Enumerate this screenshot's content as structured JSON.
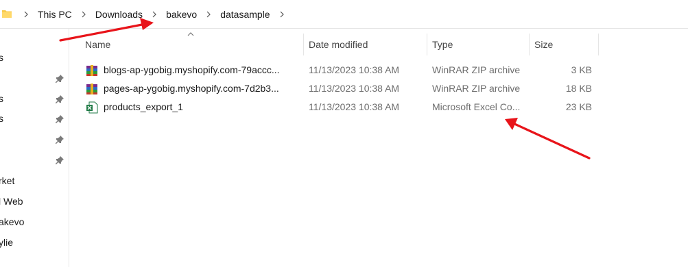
{
  "breadcrumb": {
    "items": [
      "This PC",
      "Downloads",
      "bakevo",
      "datasample"
    ]
  },
  "nav_pane": {
    "items": [
      {
        "label": "s",
        "pinned": false
      },
      {
        "label": "s",
        "pinned": true
      },
      {
        "label": "s",
        "pinned": true
      },
      {
        "label": "",
        "pinned": true
      },
      {
        "label": "",
        "pinned": true
      },
      {
        "label": "rket",
        "pinned": false
      },
      {
        "label": "l Web",
        "pinned": false
      },
      {
        "label": "akevo",
        "pinned": false
      },
      {
        "label": "ylie",
        "pinned": false
      }
    ]
  },
  "columns": {
    "name": "Name",
    "date": "Date modified",
    "type": "Type",
    "size": "Size"
  },
  "files": [
    {
      "icon": "winrar-archive-icon",
      "name": "blogs-ap-ygobig.myshopify.com-79accc...",
      "date": "11/13/2023 10:38 AM",
      "type": "WinRAR ZIP archive",
      "size": "3 KB"
    },
    {
      "icon": "winrar-archive-icon",
      "name": "pages-ap-ygobig.myshopify.com-7d2b3...",
      "date": "11/13/2023 10:38 AM",
      "type": "WinRAR ZIP archive",
      "size": "18 KB"
    },
    {
      "icon": "excel-file-icon",
      "name": "products_export_1",
      "date": "11/13/2023 10:38 AM",
      "type": "Microsoft Excel Co...",
      "size": "23 KB"
    }
  ],
  "colors": {
    "annotation_arrow": "#e8141a",
    "folder_yellow": "#f7c948",
    "excel_green": "#1f7a45"
  }
}
